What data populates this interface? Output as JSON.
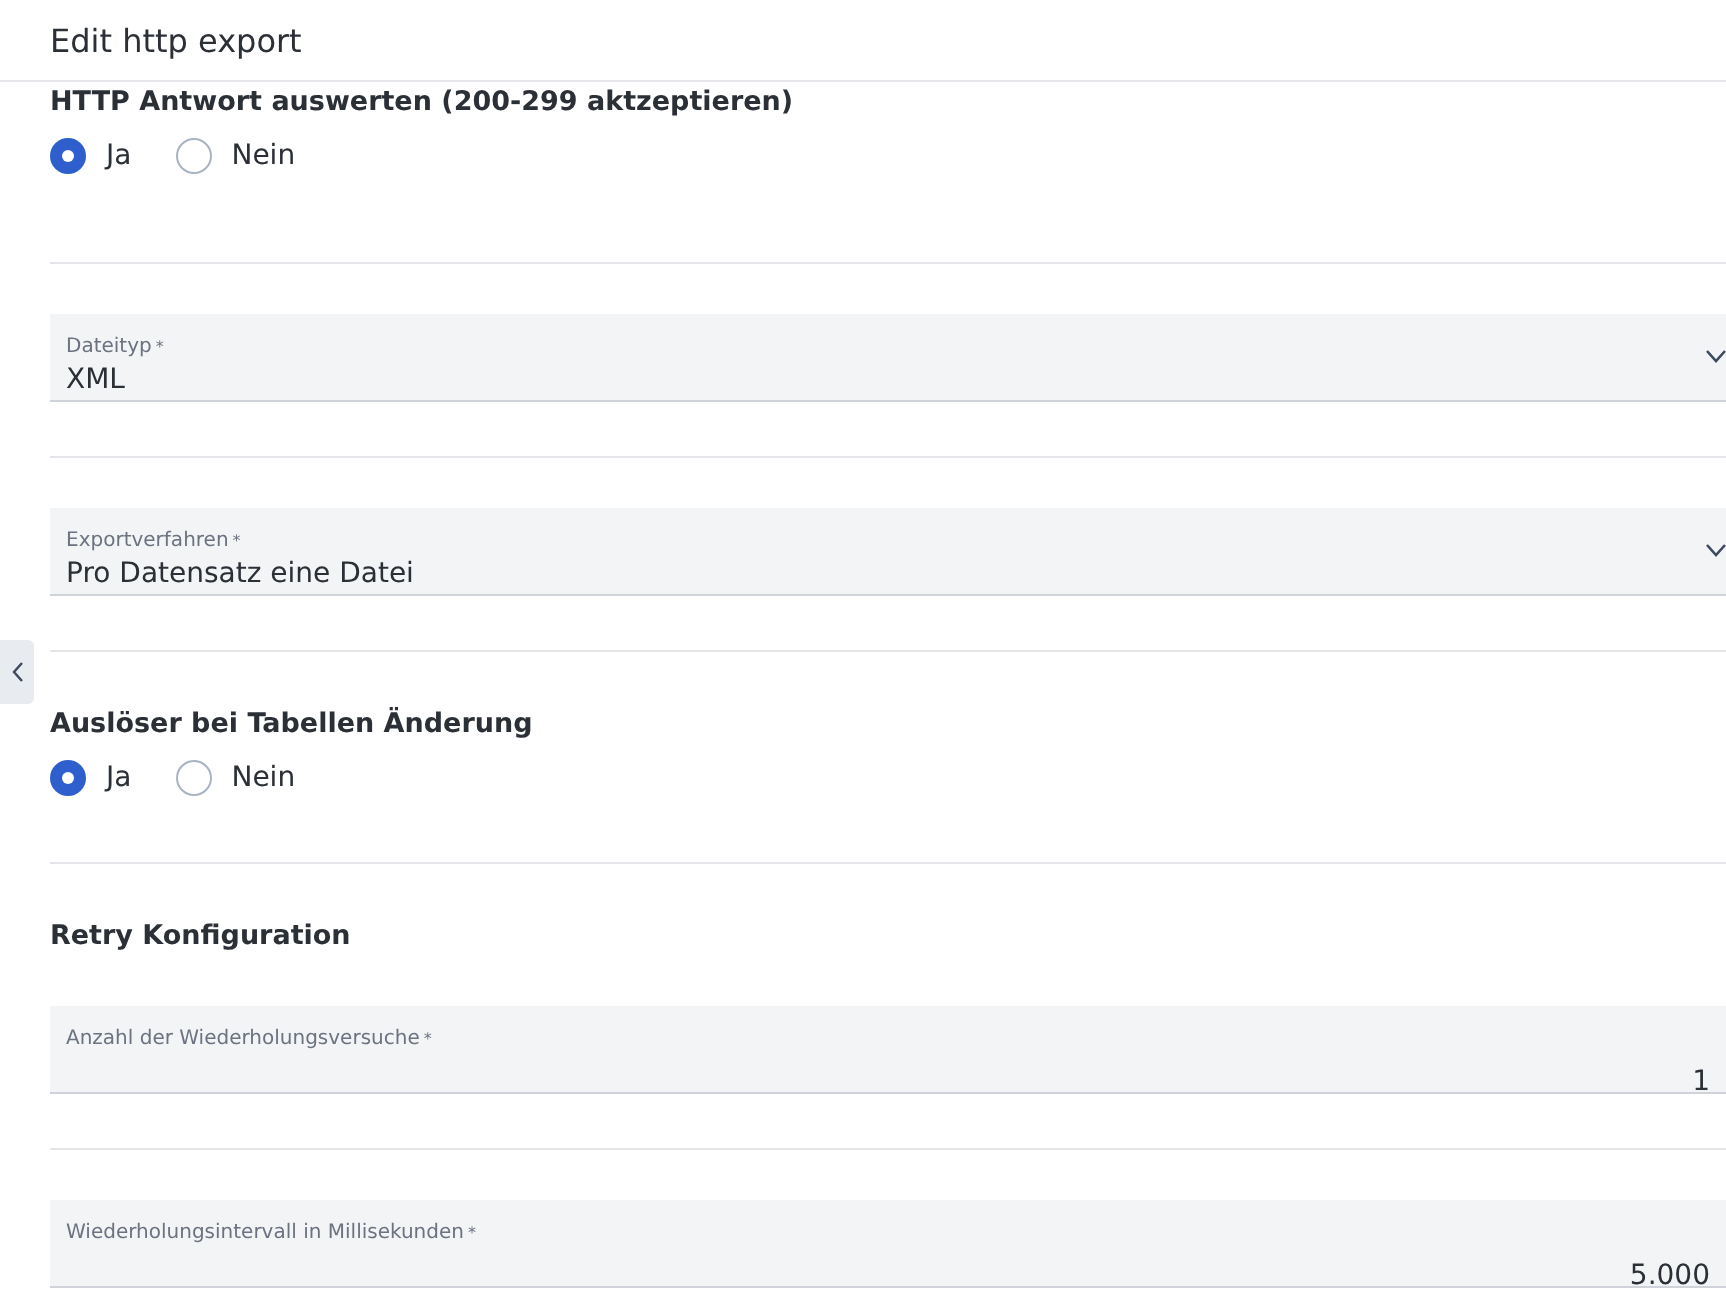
{
  "window": {
    "title": "Edit http export"
  },
  "sections": [
    {
      "kind": "radio_group",
      "title": "HTTP Antwort auswerten (200-299 aktzeptieren)",
      "options": [
        {
          "label": "Ja",
          "selected": true
        },
        {
          "label": "Nein",
          "selected": false
        }
      ]
    },
    {
      "kind": "select",
      "label": "Dateityp",
      "required_mark": "*",
      "value": "XML"
    },
    {
      "kind": "select",
      "label": "Exportverfahren",
      "required_mark": "*",
      "value": "Pro Datensatz eine Datei"
    },
    {
      "kind": "radio_group",
      "title": "Auslöser bei Tabellen Änderung",
      "options": [
        {
          "label": "Ja",
          "selected": true
        },
        {
          "label": "Nein",
          "selected": false
        }
      ]
    },
    {
      "kind": "heading",
      "title": "Retry Konfiguration"
    },
    {
      "kind": "number",
      "label": "Anzahl der Wiederholungsversuche",
      "required_mark": "*",
      "value": "1"
    },
    {
      "kind": "number",
      "label": "Wiederholungsintervall in Millisekunden",
      "required_mark": "*",
      "value": "5.000"
    }
  ]
}
